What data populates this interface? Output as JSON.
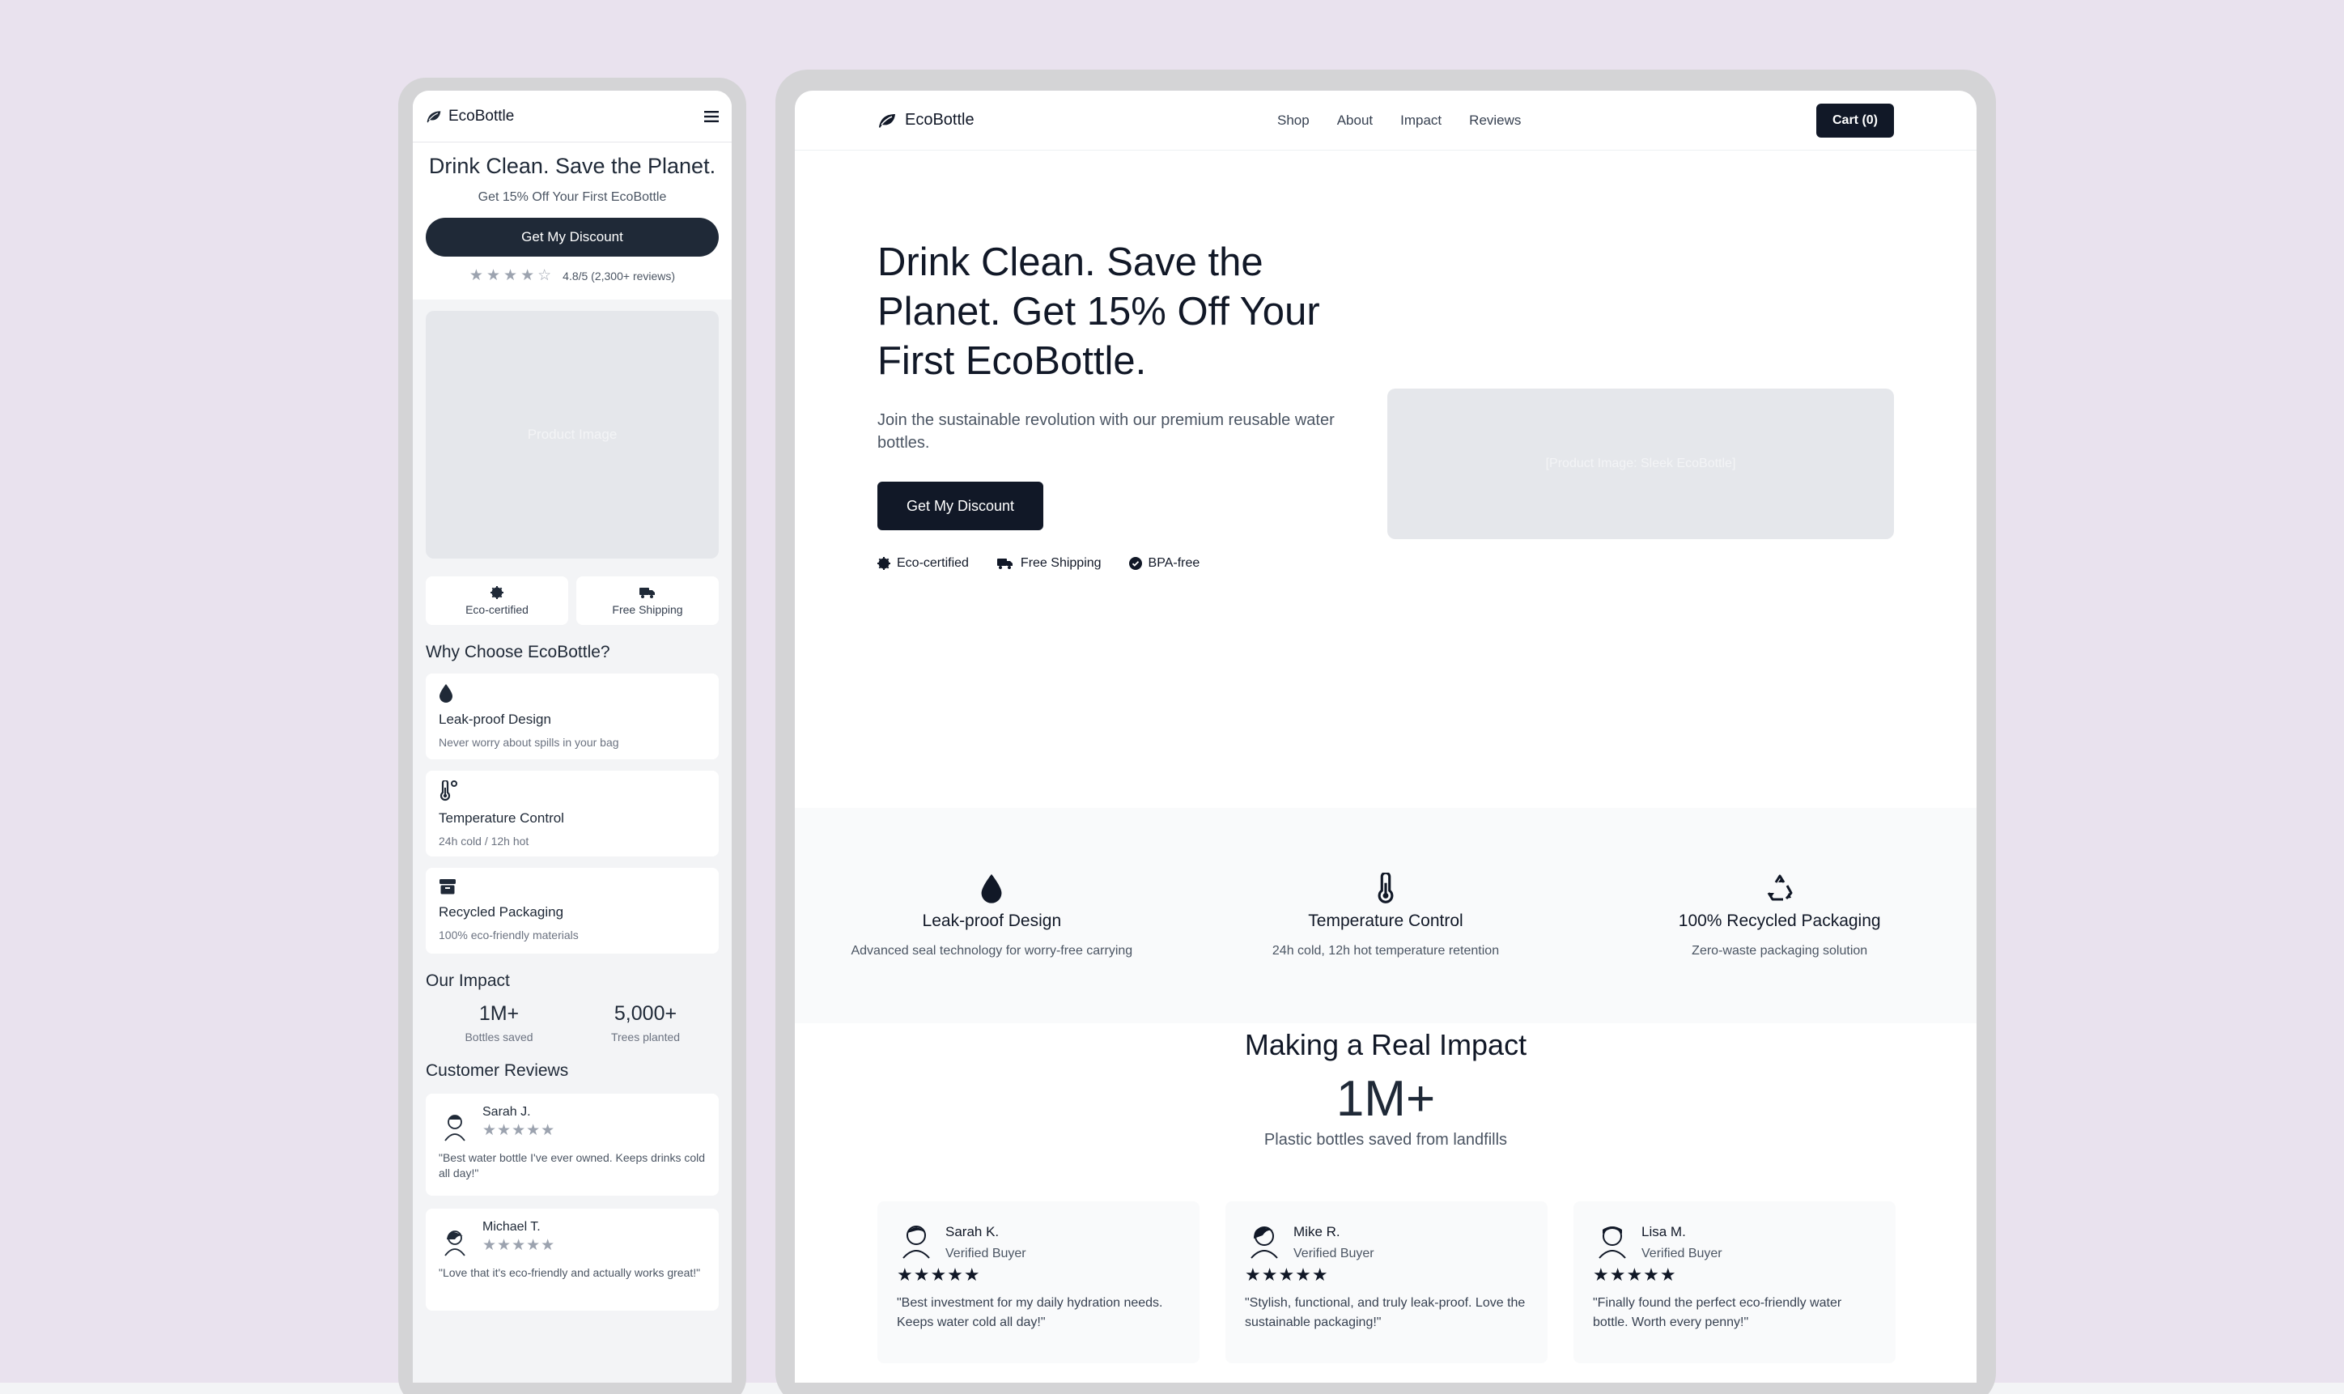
{
  "mobile": {
    "brand": "EcoBottle",
    "hero": {
      "title": "Drink Clean. Save the Planet.",
      "subtitle": "Get 15% Off Your First EcoBottle",
      "cta": "Get My Discount",
      "rating_text": "4.8/5 (2,300+ reviews)",
      "image_placeholder": "Product Image"
    },
    "badges": [
      {
        "label": "Eco-certified",
        "icon": "leaf-badge-icon"
      },
      {
        "label": "Free Shipping",
        "icon": "truck-icon"
      }
    ],
    "why_title": "Why Choose EcoBottle?",
    "features": [
      {
        "title": "Leak-proof Design",
        "desc": "Never worry about spills in your bag",
        "icon": "droplet-icon"
      },
      {
        "title": "Temperature Control",
        "desc": "24h cold / 12h hot",
        "icon": "thermometer-icon"
      },
      {
        "title": "Recycled Packaging",
        "desc": "100% eco-friendly materials",
        "icon": "box-icon"
      }
    ],
    "impact_title": "Our Impact",
    "stats": [
      {
        "value": "1M+",
        "label": "Bottles saved"
      },
      {
        "value": "5,000+",
        "label": "Trees planted"
      }
    ],
    "reviews_title": "Customer Reviews",
    "reviews": [
      {
        "name": "Sarah J.",
        "text": "\"Best water bottle I've ever owned. Keeps drinks cold all day!\""
      },
      {
        "name": "Michael T.",
        "text": "\"Love that it's eco-friendly and actually works great!\""
      }
    ]
  },
  "desktop": {
    "brand": "EcoBottle",
    "nav": [
      "Shop",
      "About",
      "Impact",
      "Reviews"
    ],
    "cart": "Cart (0)",
    "hero": {
      "title": "Drink Clean. Save the Planet. Get 15% Off Your First EcoBottle.",
      "lead": "Join the sustainable revolution with our premium reusable water bottles.",
      "cta": "Get My Discount",
      "image_placeholder": "[Product Image: Sleek EcoBottle]"
    },
    "badges": [
      {
        "label": "Eco-certified",
        "icon": "leaf-badge-icon"
      },
      {
        "label": "Free Shipping",
        "icon": "truck-icon"
      },
      {
        "label": "BPA-free",
        "icon": "check-circle-icon"
      }
    ],
    "features": [
      {
        "title": "Leak-proof Design",
        "desc": "Advanced seal technology for worry-free carrying",
        "icon": "droplet-icon"
      },
      {
        "title": "Temperature Control",
        "desc": "24h cold, 12h hot temperature retention",
        "icon": "thermometer-icon"
      },
      {
        "title": "100% Recycled Packaging",
        "desc": "Zero-waste packaging solution",
        "icon": "recycle-icon"
      }
    ],
    "impact": {
      "title": "Making a Real Impact",
      "number": "1M+",
      "label": "Plastic bottles saved from landfills"
    },
    "reviews": [
      {
        "name": "Sarah K.",
        "role": "Verified Buyer",
        "text": "\"Best investment for my daily hydration needs. Keeps water cold all day!\""
      },
      {
        "name": "Mike R.",
        "role": "Verified Buyer",
        "text": "\"Stylish, functional, and truly leak-proof. Love the sustainable packaging!\""
      },
      {
        "name": "Lisa M.",
        "role": "Verified Buyer",
        "text": "\"Finally found the perfect eco-friendly water bottle. Worth every penny!\""
      }
    ]
  },
  "colors": {
    "page_bg": "#e9e2ee",
    "device_frame": "#d4d4d6",
    "primary_dark": "#111827",
    "placeholder": "#e5e7eb"
  },
  "ratings": {
    "mobile_hero_stars": 4.5,
    "review_stars": 5
  }
}
